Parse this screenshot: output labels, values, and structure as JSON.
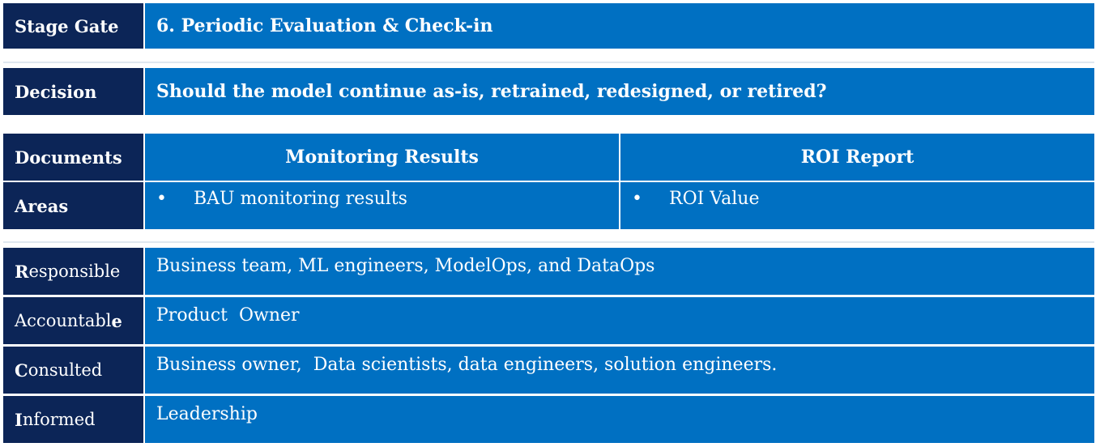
{
  "stage_gate": {
    "label": "Stage Gate",
    "value": "6. Periodic Evaluation & Check-in"
  },
  "decision": {
    "label": "Decision",
    "value": "Should the model continue as-is, retrained, redesigned, or retired?"
  },
  "documents": {
    "label": "Documents",
    "col1": "Monitoring Results",
    "col2": "ROI Report"
  },
  "areas": {
    "label": "Areas",
    "bullet": "•",
    "col1": "BAU monitoring results",
    "col2": "ROI Value"
  },
  "raci": [
    {
      "first": "R",
      "rest": "esponsible",
      "value": "Business team, ML engineers, ModelOps, and DataOps"
    },
    {
      "first": "",
      "rest": "Accountabl",
      "tail": "e",
      "value": "Product  Owner"
    },
    {
      "first": "C",
      "rest": "onsulted",
      "value": "Business owner,  Data scientists, data engineers, solution engineers."
    },
    {
      "first": "I",
      "rest": "nformed",
      "value": "Leadership"
    }
  ],
  "colors": {
    "label_bg": "#0c2557",
    "cell_bg": "#0070c2"
  }
}
